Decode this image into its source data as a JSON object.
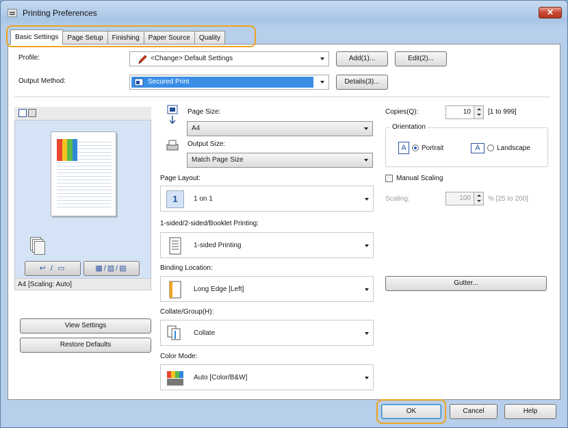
{
  "window": {
    "title": "Printing Preferences",
    "close_label": "✕"
  },
  "tabs": [
    {
      "label": "Basic Settings"
    },
    {
      "label": "Page Setup"
    },
    {
      "label": "Finishing"
    },
    {
      "label": "Paper Source"
    },
    {
      "label": "Quality"
    }
  ],
  "profile": {
    "label": "Profile:",
    "value": "<Change> Default Settings",
    "add_label": "Add(1)...",
    "edit_label": "Edit(2)..."
  },
  "output_method": {
    "label": "Output Method:",
    "value": "Secured Print",
    "details_label": "Details(3)..."
  },
  "preview": {
    "status": "A4 [Scaling: Auto]",
    "btn1": "↩ / ▭",
    "btn2": "▦/▥/▤"
  },
  "page_size": {
    "label": "Page Size:",
    "value": "A4"
  },
  "output_size": {
    "label": "Output Size:",
    "value": "Match Page Size"
  },
  "page_layout": {
    "label": "Page Layout:",
    "value": "1 on 1",
    "icon_text": "1"
  },
  "duplex": {
    "label": "1-sided/2-sided/Booklet Printing:",
    "value": "1-sided Printing"
  },
  "binding": {
    "label": "Binding Location:",
    "value": "Long Edge [Left]"
  },
  "collate": {
    "label": "Collate/Group(H):",
    "value": "Collate"
  },
  "color_mode": {
    "label": "Color Mode:",
    "value": "Auto [Color/B&W]"
  },
  "copies": {
    "label": "Copies(Q):",
    "value": "10",
    "range": "[1 to 999]"
  },
  "orientation": {
    "label": "Orientation",
    "portrait": "Portrait",
    "landscape": "Landscape",
    "glyph": "A"
  },
  "manual_scaling": {
    "label": "Manual Scaling",
    "scaling_label": "Scaling:",
    "value": "100",
    "range": "% [25 to 200]"
  },
  "gutter_label": "Gutter...",
  "view_settings_label": "View Settings",
  "restore_defaults_label": "Restore Defaults",
  "footer": {
    "ok": "OK",
    "cancel": "Cancel",
    "help": "Help"
  }
}
